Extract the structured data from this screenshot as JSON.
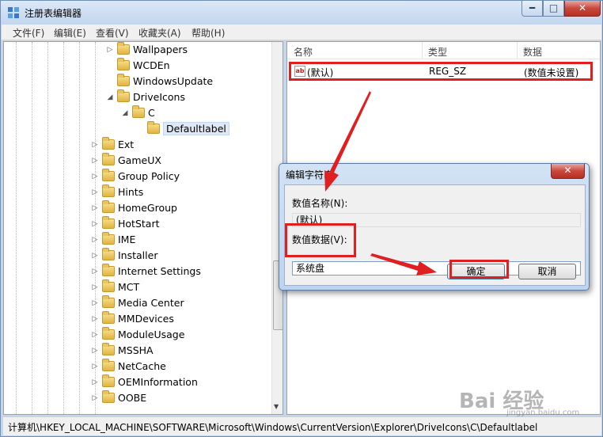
{
  "window": {
    "title": "注册表编辑器"
  },
  "captions": {
    "minimize": "━",
    "maximize": "□",
    "close": "✕"
  },
  "menu": [
    "文件(F)",
    "编辑(E)",
    "查看(V)",
    "收藏夹(A)",
    "帮助(H)"
  ],
  "tree": [
    {
      "label": "Wallpapers",
      "expander": "right"
    },
    {
      "label": "WCDEn",
      "expander": "none"
    },
    {
      "label": "WindowsUpdate",
      "expander": "none"
    },
    {
      "label": "DriveIcons",
      "expander": "down"
    },
    {
      "label": "C",
      "expander": "down"
    },
    {
      "label": "Defaultlabel",
      "expander": "none",
      "selected": true
    },
    {
      "label": "Ext",
      "expander": "right"
    },
    {
      "label": "GameUX",
      "expander": "right"
    },
    {
      "label": "Group Policy",
      "expander": "right"
    },
    {
      "label": "Hints",
      "expander": "right"
    },
    {
      "label": "HomeGroup",
      "expander": "right"
    },
    {
      "label": "HotStart",
      "expander": "right"
    },
    {
      "label": "IME",
      "expander": "right"
    },
    {
      "label": "Installer",
      "expander": "right"
    },
    {
      "label": "Internet Settings",
      "expander": "right"
    },
    {
      "label": "MCT",
      "expander": "right"
    },
    {
      "label": "Media Center",
      "expander": "right"
    },
    {
      "label": "MMDevices",
      "expander": "right"
    },
    {
      "label": "ModuleUsage",
      "expander": "right"
    },
    {
      "label": "MSSHA",
      "expander": "right"
    },
    {
      "label": "NetCache",
      "expander": "right"
    },
    {
      "label": "OEMInformation",
      "expander": "right"
    },
    {
      "label": "OOBE",
      "expander": "right"
    }
  ],
  "list": {
    "columns": [
      "名称",
      "类型",
      "数据"
    ],
    "row": {
      "icon": "ab",
      "name": "(默认)",
      "type": "REG_SZ",
      "data": "(数值未设置)"
    }
  },
  "dialog": {
    "title": "编辑字符串",
    "close": "✕",
    "value_name_label": "数值名称(N):",
    "value_name": "(默认)",
    "value_data_label": "数值数据(V):",
    "value_data": "系统盘",
    "ok": "确定",
    "cancel": "取消"
  },
  "status": "计算机\\HKEY_LOCAL_MACHINE\\SOFTWARE\\Microsoft\\Windows\\CurrentVersion\\Explorer\\DriveIcons\\C\\Defaultlabel",
  "watermark": {
    "main": "Bai 经验",
    "sub": "jingyan.baidu.com"
  },
  "colors": {
    "annotation": "#e02020",
    "selection": "#dfe8f5"
  }
}
